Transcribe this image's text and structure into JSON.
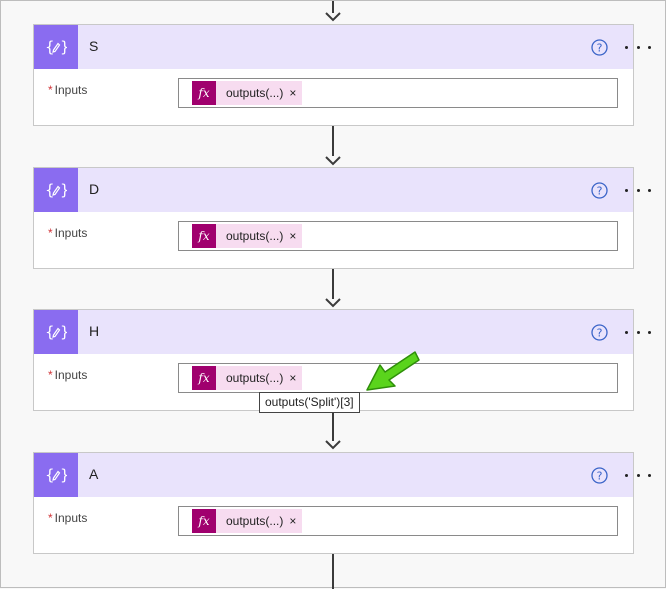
{
  "actions": [
    {
      "title": "S",
      "inputs_label": "Inputs",
      "required_mark": "*",
      "token_text": "outputs(...)",
      "token_remove": "×",
      "fx": "fx",
      "help": "?"
    },
    {
      "title": "D",
      "inputs_label": "Inputs",
      "required_mark": "*",
      "token_text": "outputs(...)",
      "token_remove": "×",
      "fx": "fx",
      "help": "?"
    },
    {
      "title": "H",
      "inputs_label": "Inputs",
      "required_mark": "*",
      "token_text": "outputs(...)",
      "token_remove": "×",
      "fx": "fx",
      "help": "?"
    },
    {
      "title": "A",
      "inputs_label": "Inputs",
      "required_mark": "*",
      "token_text": "outputs(...)",
      "token_remove": "×",
      "fx": "fx",
      "help": "?"
    }
  ],
  "tooltip": {
    "text": "outputs('Split')[3]"
  },
  "icons": {
    "action": "compose-icon",
    "help": "help-circle-icon",
    "more": "more-options-icon",
    "function": "expression-fx-icon",
    "annotation": "green-pointer-arrow"
  },
  "colors": {
    "header_bg": "#e9e3fc",
    "action_icon_bg": "#8a6cf0",
    "fx_bg": "#a0006e",
    "token_bg": "#f7dcf0",
    "help_blue": "#3a64c8",
    "required_red": "#d13438",
    "annotation_green": "#5ad41c"
  }
}
